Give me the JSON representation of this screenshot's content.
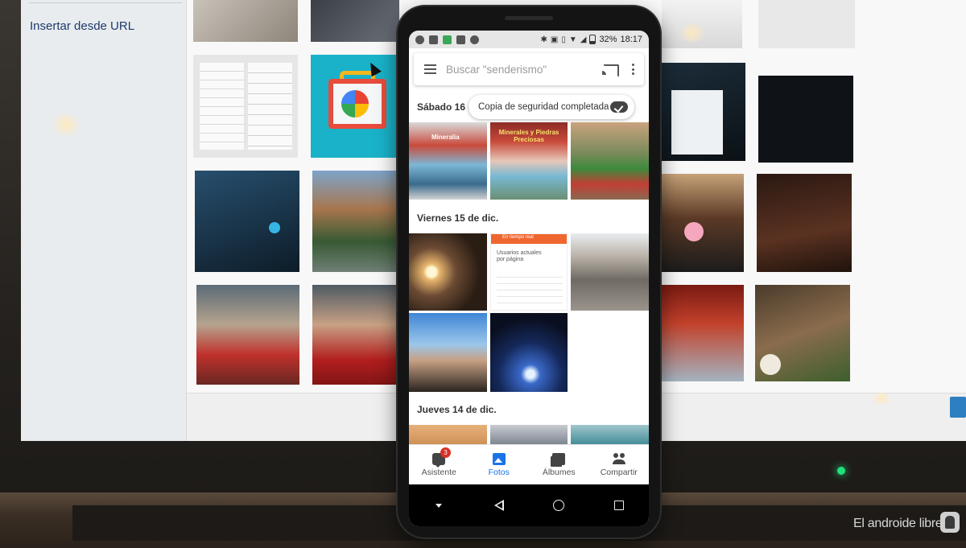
{
  "background": {
    "insert_url_link": "Insertar desde URL",
    "watermark": "El androide libre"
  },
  "status_bar": {
    "battery": "32%",
    "time": "18:17",
    "icons": [
      "telegram-icon",
      "message-icon",
      "shield-icon",
      "email-icon",
      "pinwheel-icon",
      "bluetooth-icon",
      "nfc-icon",
      "vibrate-icon",
      "wifi-icon",
      "signal-icon",
      "battery-icon"
    ]
  },
  "search": {
    "placeholder": "Buscar \"senderismo\""
  },
  "toast": {
    "text": "Copia de seguridad completada"
  },
  "sections": [
    {
      "date": "Sábado 16 d"
    },
    {
      "date": "Viernes 15 de dic."
    },
    {
      "date": "Jueves 14 de dic."
    }
  ],
  "photos": {
    "p1_label": "Mineralia",
    "p2_label": "Minerales y Piedras Preciosas",
    "p5_header": "En tiempo real",
    "p5_title": "Usuarios actuales por página"
  },
  "bottom_nav": [
    {
      "label": "Asistente",
      "badge": "3"
    },
    {
      "label": "Fotos"
    },
    {
      "label": "Álbumes"
    },
    {
      "label": "Compartir"
    }
  ],
  "colors": {
    "accent": "#1a73e8",
    "badge": "#d93025"
  }
}
